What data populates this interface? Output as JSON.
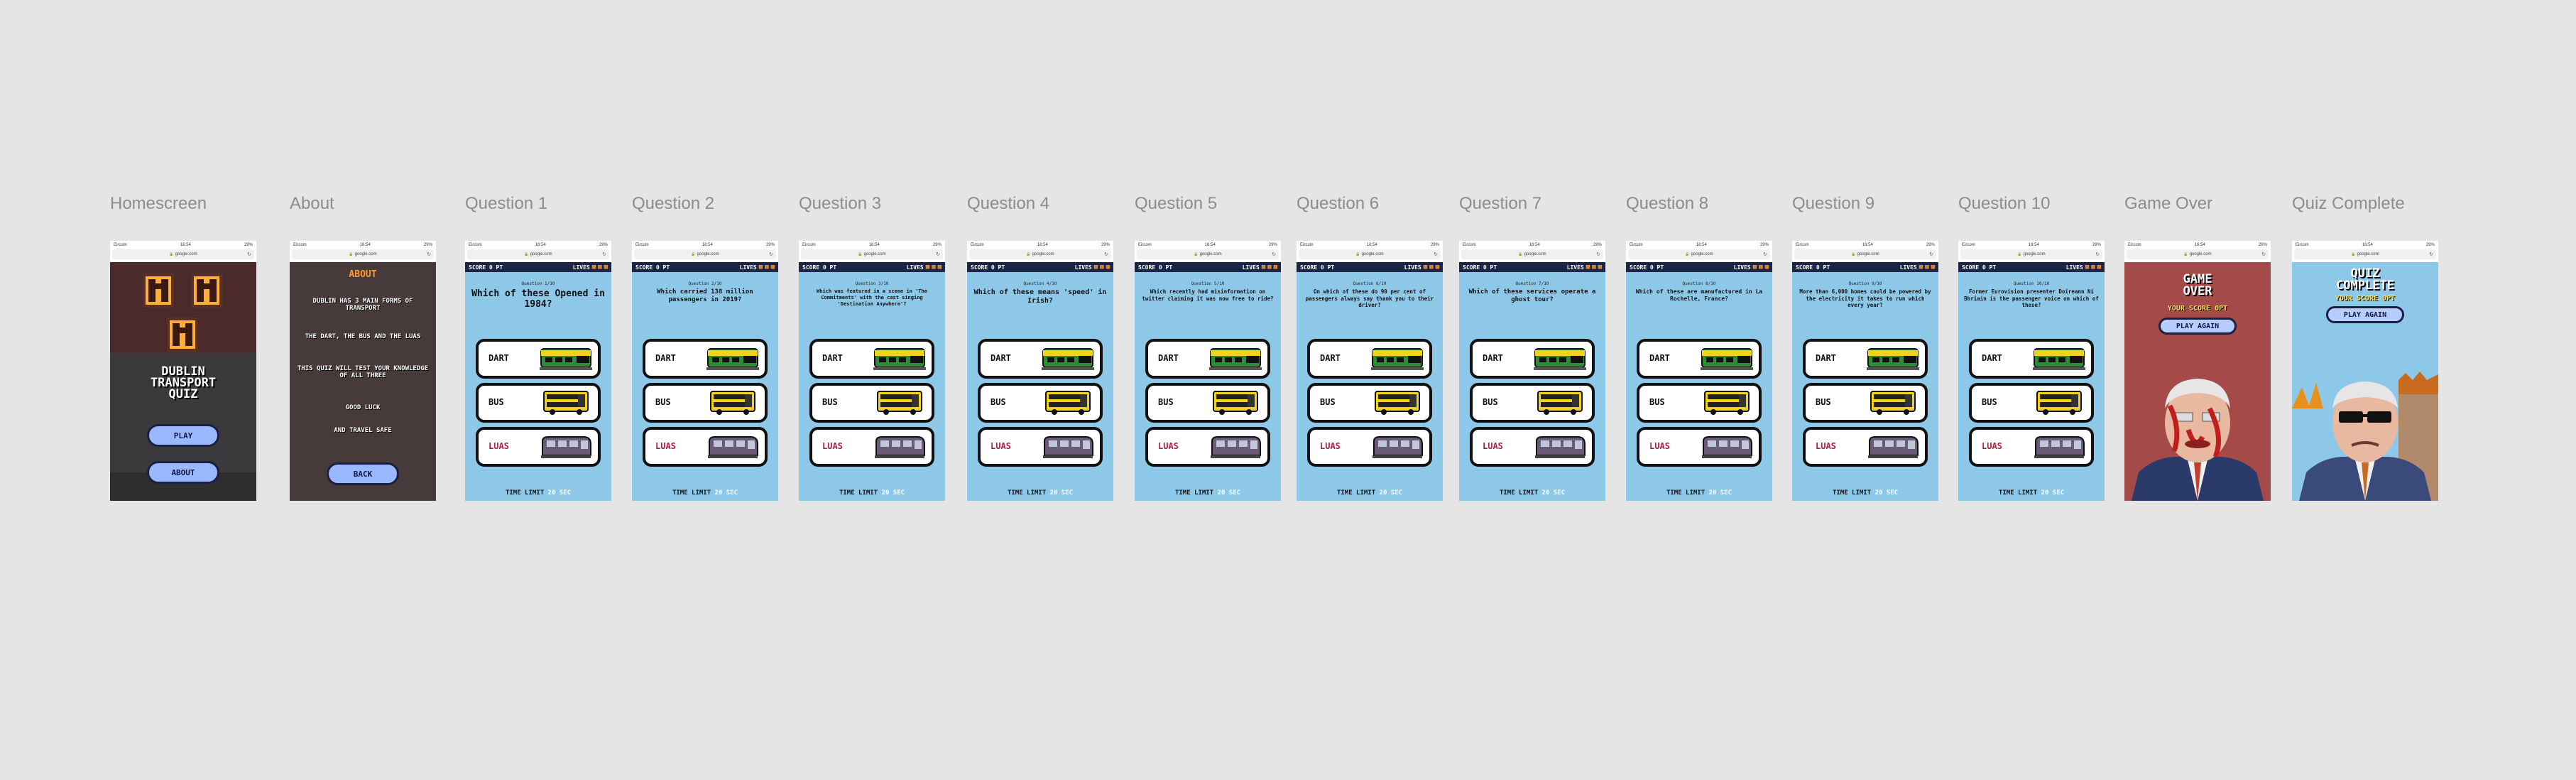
{
  "browser": {
    "carrier": "Eircom",
    "time": "16:54",
    "battery": "29%",
    "url": "google.com"
  },
  "home": {
    "frame_label": "Homescreen",
    "title_lines": [
      "DUBLIN",
      "TRANSPORT",
      "QUIZ"
    ],
    "play_label": "PLAY",
    "about_label": "ABOUT"
  },
  "about": {
    "frame_label": "About",
    "heading": "ABOUT",
    "lines": [
      "DUBLIN HAS 3 MAIN FORMS OF TRANSPORT",
      "THE DART, THE BUS AND THE LUAS",
      "THIS QUIZ WILL TEST YOUR KNOWLEDGE OF ALL THREE",
      "GOOD LUCK",
      "AND TRAVEL SAFE"
    ],
    "back_label": "BACK"
  },
  "quiz": {
    "score_label": "SCORE",
    "score_value": "0 PT",
    "lives_label": "LIVES",
    "options": [
      "DART",
      "BUS",
      "LUAS"
    ],
    "time_label": "TIME LIMIT",
    "time_value": "20 SEC",
    "questions": [
      {
        "frame_label": "Question 1",
        "number": "Question 1/10",
        "text": "Which of these Opened in 1984?"
      },
      {
        "frame_label": "Question 2",
        "number": "Question 2/10",
        "text": "Which carried 138 million passengers in 2019?"
      },
      {
        "frame_label": "Question 3",
        "number": "Question 3/10",
        "text": "Which was featured in a scene in 'The Commitments' with the cast singing 'Destination Anywhere'?"
      },
      {
        "frame_label": "Question 4",
        "number": "Question 4/10",
        "text": "Which of these means 'speed' in Irish?"
      },
      {
        "frame_label": "Question 5",
        "number": "Question 5/10",
        "text": "Which recently had misinformation on twitter claiming it was now free to ride?"
      },
      {
        "frame_label": "Question 6",
        "number": "Question 6/10",
        "text": "On which of these do 90 per cent of passengers always say thank you to their driver?"
      },
      {
        "frame_label": "Question 7",
        "number": "Question 7/10",
        "text": "Which of these services operate a ghost tour?"
      },
      {
        "frame_label": "Question 8",
        "number": "Question 8/10",
        "text": "Which of these are manufactured in La Rochelle, France?"
      },
      {
        "frame_label": "Question 9",
        "number": "Question 9/10",
        "text": "More than 6,000 homes could be powered by the electricity it takes to run which every year?"
      },
      {
        "frame_label": "Question 10",
        "number": "Question 10/10",
        "text": "Former Eurovision presenter Doireann Ní Bhriain is the passenger voice on which of these?"
      }
    ]
  },
  "game_over": {
    "frame_label": "Game Over",
    "title_lines": [
      "GAME",
      "OVER"
    ],
    "score_text": "YOUR SCORE 0PT",
    "button": "PLAY AGAIN"
  },
  "quiz_complete": {
    "frame_label": "Quiz Complete",
    "title_lines": [
      "QUIZ",
      "COMPLETE"
    ],
    "score_text": "YOUR SCORE 0PT",
    "button": "PLAY AGAIN"
  },
  "colors": {
    "quiz_bg": "#8ec8e8",
    "topbar": "#1c2545",
    "life": "#ff9a3a",
    "button": "#9ab8ff",
    "dart_green": "#2f8a3a",
    "bus_yellow": "#f2d21c",
    "luas_purple": "#6a5a78"
  }
}
